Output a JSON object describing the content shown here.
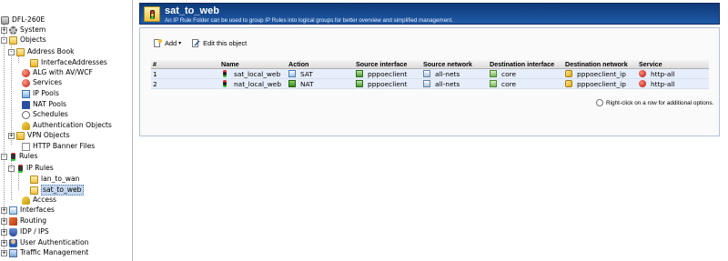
{
  "tree": {
    "root": "DFL-260E",
    "items": [
      {
        "label": "System",
        "expander": "+"
      },
      {
        "label": "Objects",
        "expander": "-"
      },
      {
        "label": "Address Book",
        "expander": "-"
      },
      {
        "label": "InterfaceAddresses",
        "expander": ""
      },
      {
        "label": "ALG with AV/WCF",
        "expander": ""
      },
      {
        "label": "Services",
        "expander": ""
      },
      {
        "label": "IP Pools",
        "expander": ""
      },
      {
        "label": "NAT Pools",
        "expander": ""
      },
      {
        "label": "Schedules",
        "expander": ""
      },
      {
        "label": "Authentication Objects",
        "expander": ""
      },
      {
        "label": "VPN Objects",
        "expander": "+"
      },
      {
        "label": "HTTP Banner Files",
        "expander": ""
      },
      {
        "label": "Rules",
        "expander": "-"
      },
      {
        "label": "IP Rules",
        "expander": "-"
      },
      {
        "label": "lan_to_wan",
        "expander": ""
      },
      {
        "label": "sat_to_web",
        "expander": ""
      },
      {
        "label": "Access",
        "expander": ""
      },
      {
        "label": "Interfaces",
        "expander": "+"
      },
      {
        "label": "Routing",
        "expander": "+"
      },
      {
        "label": "IDP / IPS",
        "expander": "+"
      },
      {
        "label": "User Authentication",
        "expander": "+"
      },
      {
        "label": "Traffic Management",
        "expander": "+"
      }
    ]
  },
  "header": {
    "title": "sat_to_web",
    "subtitle": "An IP Rule Folder can be used to group IP Rules into logical groups for better overview and simplified management."
  },
  "toolbar": {
    "add_label": "Add",
    "add_caret": "▾",
    "edit_label": "Edit this object"
  },
  "grid": {
    "columns": [
      "#",
      "Name",
      "Action",
      "Source interface",
      "Source network",
      "Destination interface",
      "Destination network",
      "Service"
    ],
    "rows": [
      {
        "num": "1",
        "name": "sat_local_web",
        "action": "SAT",
        "src_if": "pppoeclient",
        "src_net": "all-nets",
        "dst_if": "core",
        "dst_net": "pppoeclient_ip",
        "service": "http-all"
      },
      {
        "num": "2",
        "name": "nat_local_web",
        "action": "NAT",
        "src_if": "pppoeclient",
        "src_net": "all-nets",
        "dst_if": "core",
        "dst_net": "pppoeclient_ip",
        "service": "http-all"
      }
    ]
  },
  "hint": "Right-click on a row for additional options.",
  "colors": {
    "header_bg": "#1f5aa8",
    "row_bg": "#e7eefb",
    "selected_bg": "#c6d8ee"
  }
}
